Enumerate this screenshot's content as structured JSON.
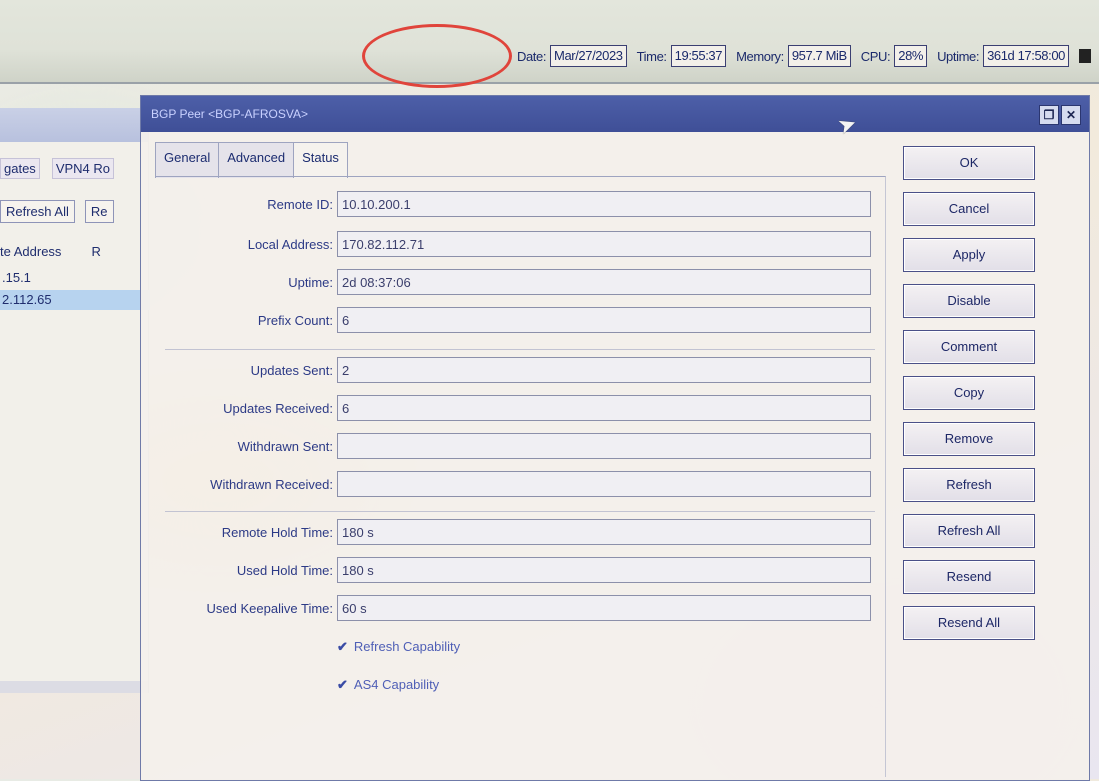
{
  "statusbar": {
    "date_label": "Date:",
    "date_value": "Mar/27/2023",
    "time_label": "Time:",
    "time_value": "19:55:37",
    "memory_label": "Memory:",
    "memory_value": "957.7 MiB",
    "cpu_label": "CPU:",
    "cpu_value": "28%",
    "uptime_label": "Uptime:",
    "uptime_value": "361d 17:58:00"
  },
  "background_window": {
    "tabs": [
      "gates",
      "VPN4 Ro"
    ],
    "toolbar": [
      "Refresh All",
      "Re"
    ],
    "columns": [
      "te Address",
      "R"
    ],
    "rows": [
      ".15.1",
      "2.112.65"
    ]
  },
  "dialog": {
    "title": "BGP Peer <BGP-AFROSVA>",
    "tabs": [
      "General",
      "Advanced",
      "Status"
    ],
    "fields": {
      "remote_id": {
        "label": "Remote ID:",
        "value": "10.10.200.1"
      },
      "local_address": {
        "label": "Local Address:",
        "value": "170.82.112.71"
      },
      "uptime": {
        "label": "Uptime:",
        "value": "2d 08:37:06"
      },
      "prefix_count": {
        "label": "Prefix Count:",
        "value": "6"
      },
      "updates_sent": {
        "label": "Updates Sent:",
        "value": "2"
      },
      "updates_received": {
        "label": "Updates Received:",
        "value": "6"
      },
      "withdrawn_sent": {
        "label": "Withdrawn Sent:",
        "value": ""
      },
      "withdrawn_received": {
        "label": "Withdrawn Received:",
        "value": ""
      },
      "remote_hold_time": {
        "label": "Remote Hold Time:",
        "value": "180 s"
      },
      "used_hold_time": {
        "label": "Used Hold Time:",
        "value": "180 s"
      },
      "used_keepalive_time": {
        "label": "Used Keepalive Time:",
        "value": "60 s"
      }
    },
    "checks": {
      "refresh_capability": "Refresh Capability",
      "as4_capability": "AS4 Capability"
    },
    "buttons": {
      "ok": "OK",
      "cancel": "Cancel",
      "apply": "Apply",
      "disable": "Disable",
      "comment": "Comment",
      "copy": "Copy",
      "remove": "Remove",
      "refresh": "Refresh",
      "refresh_all": "Refresh All",
      "resend": "Resend",
      "resend_all": "Resend All"
    }
  }
}
